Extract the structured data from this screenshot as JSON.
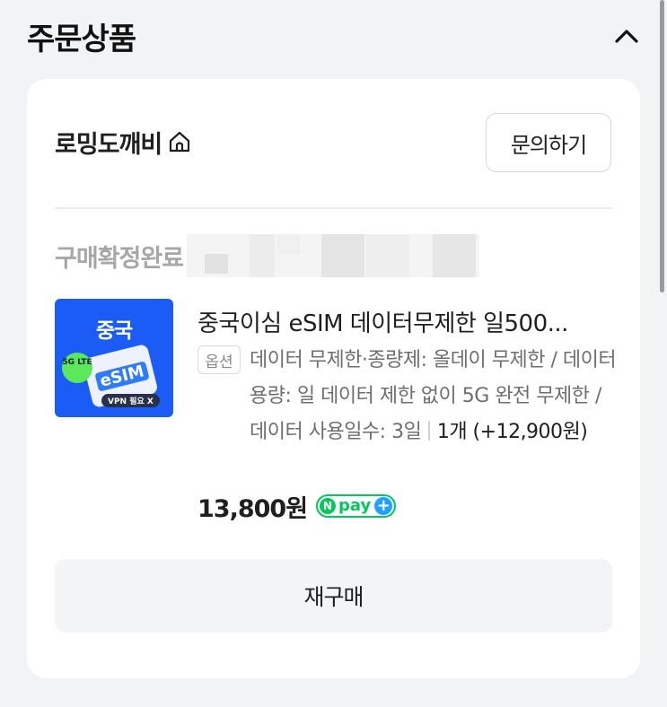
{
  "section": {
    "title": "주문상품",
    "collapse_icon": "chevron-up-icon"
  },
  "seller": {
    "name": "로밍도깨비",
    "home_icon": "home-icon",
    "inquiry_label": "문의하기"
  },
  "order": {
    "status": "구매확정완료"
  },
  "product": {
    "thumbnail": {
      "title": "중국",
      "network": "5G LTE",
      "card_label": "eSIM",
      "vpn_label": "VPN 필요 X",
      "bg_color": "#1a5cf5"
    },
    "title": "중국이심 eSIM 데이터무제한 일500...",
    "option_label": "옵션",
    "option_text": "데이터 무제한·종량제: 올데이 무제한 / 데이터 용량: 일 데이터 제한 없이 5G 완전 무제한 / 데이터 사용일수: 3일",
    "quantity_text": "1개 (+12,900원)",
    "price": "13,800원",
    "npay_n": "N",
    "npay_label": "pay",
    "npay_plus": "+",
    "npay_color": "#03c75a"
  },
  "actions": {
    "repurchase_label": "재구매"
  }
}
